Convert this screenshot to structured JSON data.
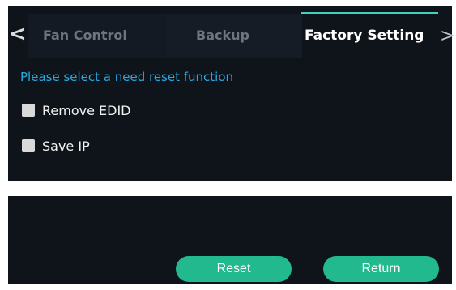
{
  "tabs": {
    "prev_arrow": "<",
    "next_arrow": ">",
    "items": [
      {
        "label": "Fan Control"
      },
      {
        "label": "Backup"
      },
      {
        "label": "Factory Setting"
      }
    ],
    "active_index": 2
  },
  "prompt": "Please select a need reset function",
  "options": [
    {
      "label": "Remove EDID",
      "checked": false
    },
    {
      "label": "Save IP",
      "checked": false
    }
  ],
  "buttons": {
    "reset": "Reset",
    "return": "Return"
  },
  "colors": {
    "panel_bg": "#0f141b",
    "accent": "#22b98e",
    "active_underline": "#3fd2bb",
    "prompt_text": "#2aa8e0"
  }
}
